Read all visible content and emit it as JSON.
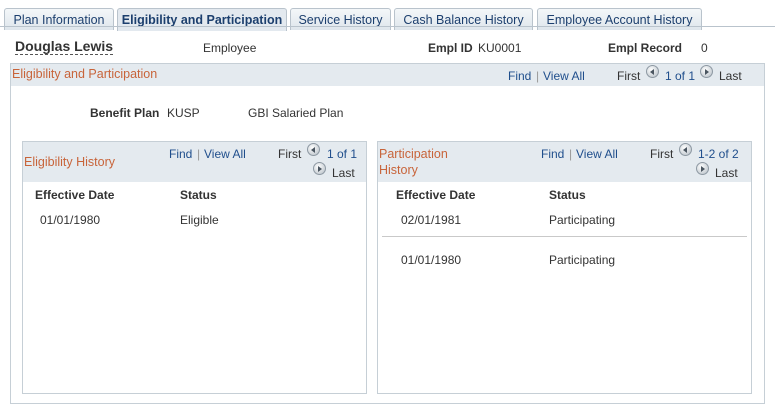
{
  "tabs": [
    {
      "label": "Plan Information",
      "active": false
    },
    {
      "label": "Eligibility and Participation",
      "active": true
    },
    {
      "label": "Service History",
      "active": false
    },
    {
      "label": "Cash Balance History",
      "active": false
    },
    {
      "label": "Employee Account History",
      "active": false
    }
  ],
  "employee": {
    "name": "Douglas Lewis",
    "type": "Employee",
    "empl_id_label": "Empl ID",
    "empl_id": "KU0001",
    "empl_record_label": "Empl Record",
    "empl_record": "0"
  },
  "main": {
    "title": "Eligibility and Participation",
    "find": "Find",
    "view_all": "View All",
    "first": "First",
    "count": "1 of 1",
    "last": "Last",
    "benefit_plan_label": "Benefit Plan",
    "benefit_plan_code": "KUSP",
    "benefit_plan_desc": "GBI Salaried Plan"
  },
  "eligibility": {
    "title": "Eligibility History",
    "find": "Find",
    "view_all": "View All",
    "first": "First",
    "count": "1 of 1",
    "last": "Last",
    "columns": [
      "Effective Date",
      "Status"
    ],
    "rows": [
      {
        "date": "01/01/1980",
        "status": "Eligible"
      }
    ]
  },
  "participation": {
    "title_line1": "Participation",
    "title_line2": "History",
    "find": "Find",
    "view_all": "View All",
    "first": "First",
    "count": "1-2 of 2",
    "last": "Last",
    "columns": [
      "Effective Date",
      "Status"
    ],
    "rows": [
      {
        "date": "02/01/1981",
        "status": "Participating"
      },
      {
        "date": "01/01/1980",
        "status": "Participating"
      }
    ]
  },
  "colors": {
    "accent": "#c8643a",
    "link": "#1f4e8c",
    "tab_text": "#1c3f6e"
  }
}
